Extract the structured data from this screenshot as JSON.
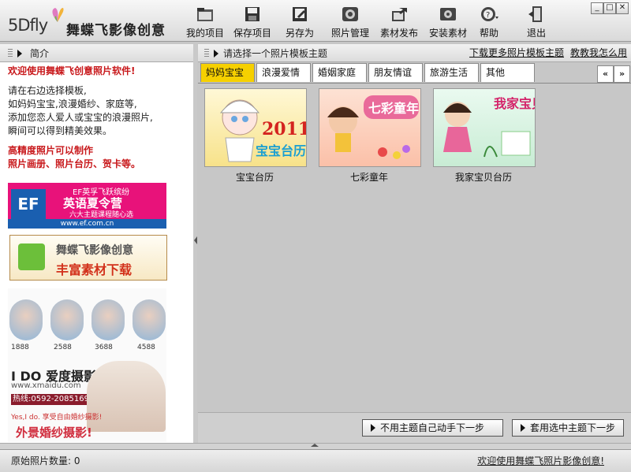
{
  "app": {
    "logo_text": "5Dfly",
    "logo_cn": "舞蝶飞影像创意"
  },
  "toolbar": {
    "buttons": [
      {
        "label": "我的项目",
        "icon": "folder-icon"
      },
      {
        "label": "保存项目",
        "icon": "floppy-save-icon"
      },
      {
        "label": "另存为",
        "icon": "save-as-icon"
      },
      {
        "label": "照片管理",
        "icon": "photo-manage-icon"
      },
      {
        "label": "素材发布",
        "icon": "publish-icon"
      },
      {
        "label": "安装素材",
        "icon": "install-icon"
      },
      {
        "label": "帮助",
        "icon": "help-icon"
      },
      {
        "label": "退出",
        "icon": "exit-icon"
      }
    ]
  },
  "window_controls": {
    "minimize": "_",
    "maximize": "□",
    "close": "✕"
  },
  "left_panel": {
    "title": "简介",
    "welcome": "欢迎使用舞蝶飞创意照片软件!",
    "lines": [
      "请在右边选择模板,",
      "如妈妈宝宝,浪漫婚纱、家庭等,",
      "添加您恋人爱人或宝宝的浪漫照片,",
      "瞬间可以得到精美效果。"
    ],
    "highlight_1": "高精度照片可以制作",
    "highlight_2": "照片画册、照片台历、贺卡等。"
  },
  "ads": {
    "ef": {
      "logo": "EF",
      "line1": "EF英孚飞跃缤纷",
      "line2": "英语夏令营",
      "line3": "六大主题课程随心选",
      "url": "www.ef.com.cn"
    },
    "download": {
      "line1": "舞蝶飞影像创意",
      "line2": "丰富素材下载"
    },
    "wedding": {
      "prices": [
        "1888",
        "2588",
        "3688",
        "4588"
      ],
      "brand": "I DO 爱度摄影",
      "url": "www.xmaidu.com",
      "tel": "热线:0592-2085169",
      "tagline": "Yes,I do. 享受自由婚纱摄影!",
      "big": "外景婚纱摄影!"
    }
  },
  "right_panel": {
    "title": "请选择一个照片模板主题",
    "link_more": "下载更多照片模板主题",
    "link_help": "教教我怎么用",
    "tabs": [
      "妈妈宝宝",
      "浪漫爱情",
      "婚姻家庭",
      "朋友情谊",
      "旅游生活",
      "其他"
    ],
    "active_tab": "妈妈宝宝",
    "nav_prev": "«",
    "nav_next": "»",
    "templates": [
      {
        "label": "宝宝台历",
        "art_text": "2011",
        "art_sub": "宝宝台历"
      },
      {
        "label": "七彩童年",
        "art_text": "七彩童年"
      },
      {
        "label": "我家宝贝台历",
        "art_text": "我家宝贝"
      }
    ],
    "btn_manual": "不用主题自己动手下一步",
    "btn_next": "套用选中主题下一步"
  },
  "status": {
    "count_label": "原始照片数量:",
    "count_value": "0",
    "welcome_link": "欢迎使用舞蝶飞照片影像创意!"
  },
  "colors": {
    "active_tab": "#f6d000",
    "red_text": "#c8181b"
  }
}
